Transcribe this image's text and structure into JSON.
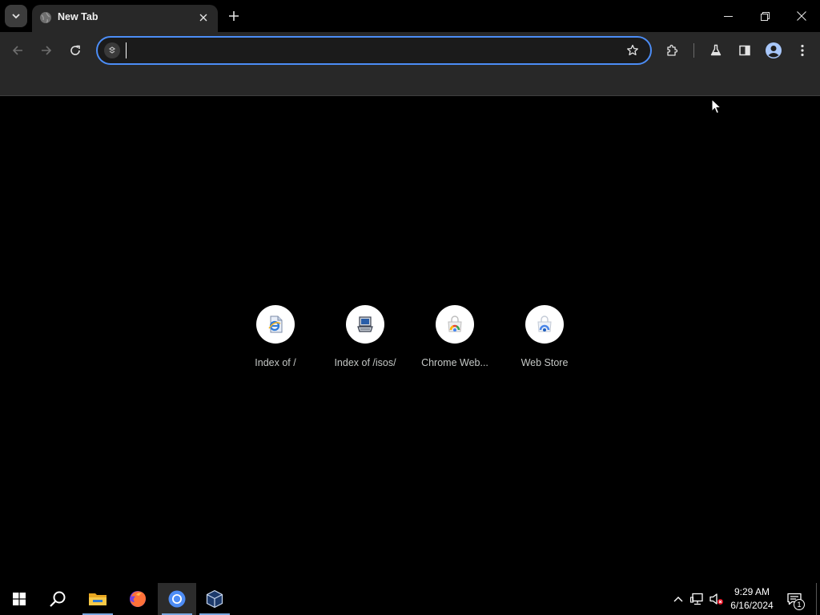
{
  "tab": {
    "title": "New Tab"
  },
  "omnibox": {
    "value": "",
    "placeholder": ""
  },
  "shortcuts": [
    {
      "label": "Index of /",
      "icon": "ie-document-icon"
    },
    {
      "label": "Index of /isos/",
      "icon": "computer-icon"
    },
    {
      "label": "Chrome Web...",
      "icon": "chrome-web-store-icon"
    },
    {
      "label": "Web Store",
      "icon": "web-store-icon"
    }
  ],
  "taskbar": {
    "apps": [
      "start",
      "search",
      "file-explorer",
      "firefox",
      "chrome",
      "virtualbox"
    ],
    "clock": {
      "time": "9:29 AM",
      "date": "6/16/2024"
    },
    "notification_count": "1"
  },
  "colors": {
    "accent": "#4c8df6",
    "toolbar": "#282828",
    "content_bg": "#000000"
  }
}
